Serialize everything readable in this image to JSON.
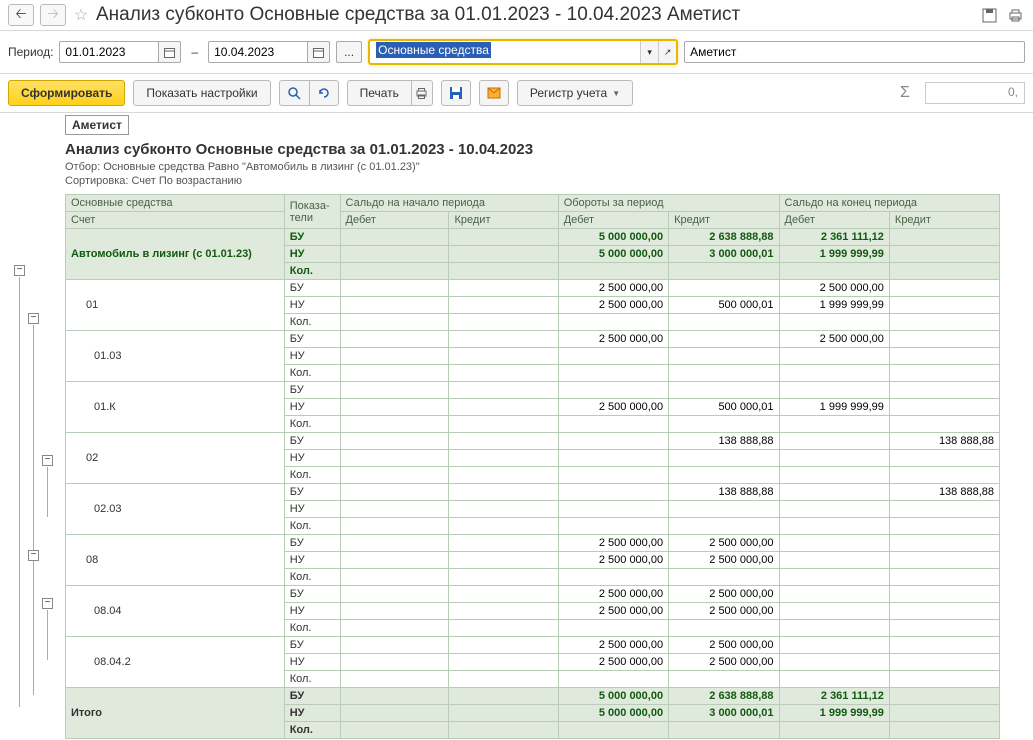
{
  "title": "Анализ субконто Основные средства за 01.01.2023 - 10.04.2023 Аметист",
  "period": {
    "label": "Период:",
    "from": "01.01.2023",
    "to": "10.04.2023",
    "dash": "–"
  },
  "subconto": "Основные средства",
  "org": "Аметист",
  "toolbar": {
    "form": "Сформировать",
    "show_settings": "Показать настройки",
    "print": "Печать",
    "register": "Регистр учета",
    "sigma_val": "0,"
  },
  "report": {
    "org": "Аметист",
    "title": "Анализ субконто Основные средства за 01.01.2023 - 10.04.2023",
    "filter": "Отбор: Основные средства Равно \"Автомобиль в лизинг (с 01.01.23)\"",
    "sort": "Сортировка: Счет По возрастанию"
  },
  "headers": {
    "h1": "Основные средства",
    "h1b": "Счет",
    "h2": "Показа-\nтели",
    "g1": "Сальдо на начало периода",
    "g2": "Обороты за период",
    "g3": "Сальдо на конец периода",
    "deb": "Дебет",
    "cred": "Кредит"
  },
  "ind": {
    "bu": "БУ",
    "nu": "НУ",
    "kol": "Кол."
  },
  "rows": [
    {
      "name": "Автомобиль в лизинг (с 01.01.23)",
      "cls": "summary",
      "bu": {
        "sd": "",
        "sk": "",
        "od": "5 000 000,00",
        "ok": "2 638 888,88",
        "ed": "2 361 111,12",
        "ek": ""
      },
      "nu": {
        "sd": "",
        "sk": "",
        "od": "5 000 000,00",
        "ok": "3 000 000,01",
        "ed": "1 999 999,99",
        "ek": ""
      },
      "kol": {
        "sd": "",
        "sk": "",
        "od": "",
        "ok": "",
        "ed": "",
        "ek": ""
      }
    },
    {
      "name": "01",
      "indent": 1,
      "bu": {
        "sd": "",
        "sk": "",
        "od": "2 500 000,00",
        "ok": "",
        "ed": "2 500 000,00",
        "ek": ""
      },
      "nu": {
        "sd": "",
        "sk": "",
        "od": "2 500 000,00",
        "ok": "500 000,01",
        "ed": "1 999 999,99",
        "ek": ""
      },
      "kol": {
        "sd": "",
        "sk": "",
        "od": "",
        "ok": "",
        "ed": "",
        "ek": ""
      }
    },
    {
      "name": "01.03",
      "indent": 2,
      "bu": {
        "sd": "",
        "sk": "",
        "od": "2 500 000,00",
        "ok": "",
        "ed": "2 500 000,00",
        "ek": ""
      },
      "nu": {
        "sd": "",
        "sk": "",
        "od": "",
        "ok": "",
        "ed": "",
        "ek": ""
      },
      "kol": {
        "sd": "",
        "sk": "",
        "od": "",
        "ok": "",
        "ed": "",
        "ek": ""
      }
    },
    {
      "name": "01.К",
      "indent": 2,
      "bu": {
        "sd": "",
        "sk": "",
        "od": "",
        "ok": "",
        "ed": "",
        "ek": ""
      },
      "nu": {
        "sd": "",
        "sk": "",
        "od": "2 500 000,00",
        "ok": "500 000,01",
        "ed": "1 999 999,99",
        "ek": ""
      },
      "kol": {
        "sd": "",
        "sk": "",
        "od": "",
        "ok": "",
        "ed": "",
        "ek": ""
      }
    },
    {
      "name": "02",
      "indent": 1,
      "bu": {
        "sd": "",
        "sk": "",
        "od": "",
        "ok": "138 888,88",
        "ed": "",
        "ek": "138 888,88"
      },
      "nu": {
        "sd": "",
        "sk": "",
        "od": "",
        "ok": "",
        "ed": "",
        "ek": ""
      },
      "kol": {
        "sd": "",
        "sk": "",
        "od": "",
        "ok": "",
        "ed": "",
        "ek": ""
      }
    },
    {
      "name": "02.03",
      "indent": 2,
      "bu": {
        "sd": "",
        "sk": "",
        "od": "",
        "ok": "138 888,88",
        "ed": "",
        "ek": "138 888,88"
      },
      "nu": {
        "sd": "",
        "sk": "",
        "od": "",
        "ok": "",
        "ed": "",
        "ek": ""
      },
      "kol": {
        "sd": "",
        "sk": "",
        "od": "",
        "ok": "",
        "ed": "",
        "ek": ""
      }
    },
    {
      "name": "08",
      "indent": 1,
      "bu": {
        "sd": "",
        "sk": "",
        "od": "2 500 000,00",
        "ok": "2 500 000,00",
        "ed": "",
        "ek": ""
      },
      "nu": {
        "sd": "",
        "sk": "",
        "od": "2 500 000,00",
        "ok": "2 500 000,00",
        "ed": "",
        "ek": ""
      },
      "kol": {
        "sd": "",
        "sk": "",
        "od": "",
        "ok": "",
        "ed": "",
        "ek": ""
      }
    },
    {
      "name": "08.04",
      "indent": 2,
      "bu": {
        "sd": "",
        "sk": "",
        "od": "2 500 000,00",
        "ok": "2 500 000,00",
        "ed": "",
        "ek": ""
      },
      "nu": {
        "sd": "",
        "sk": "",
        "od": "2 500 000,00",
        "ok": "2 500 000,00",
        "ed": "",
        "ek": ""
      },
      "kol": {
        "sd": "",
        "sk": "",
        "od": "",
        "ok": "",
        "ed": "",
        "ek": ""
      }
    },
    {
      "name": "08.04.2",
      "indent": 2,
      "bu": {
        "sd": "",
        "sk": "",
        "od": "2 500 000,00",
        "ok": "2 500 000,00",
        "ed": "",
        "ek": ""
      },
      "nu": {
        "sd": "",
        "sk": "",
        "od": "2 500 000,00",
        "ok": "2 500 000,00",
        "ed": "",
        "ek": ""
      },
      "kol": {
        "sd": "",
        "sk": "",
        "od": "",
        "ok": "",
        "ed": "",
        "ek": ""
      }
    },
    {
      "name": "Итого",
      "cls": "total",
      "bu": {
        "sd": "",
        "sk": "",
        "od": "5 000 000,00",
        "ok": "2 638 888,88",
        "ed": "2 361 111,12",
        "ek": ""
      },
      "nu": {
        "sd": "",
        "sk": "",
        "od": "5 000 000,00",
        "ok": "3 000 000,01",
        "ed": "1 999 999,99",
        "ek": ""
      },
      "kol": {
        "sd": "",
        "sk": "",
        "od": "",
        "ok": "",
        "ed": "",
        "ek": ""
      }
    }
  ]
}
